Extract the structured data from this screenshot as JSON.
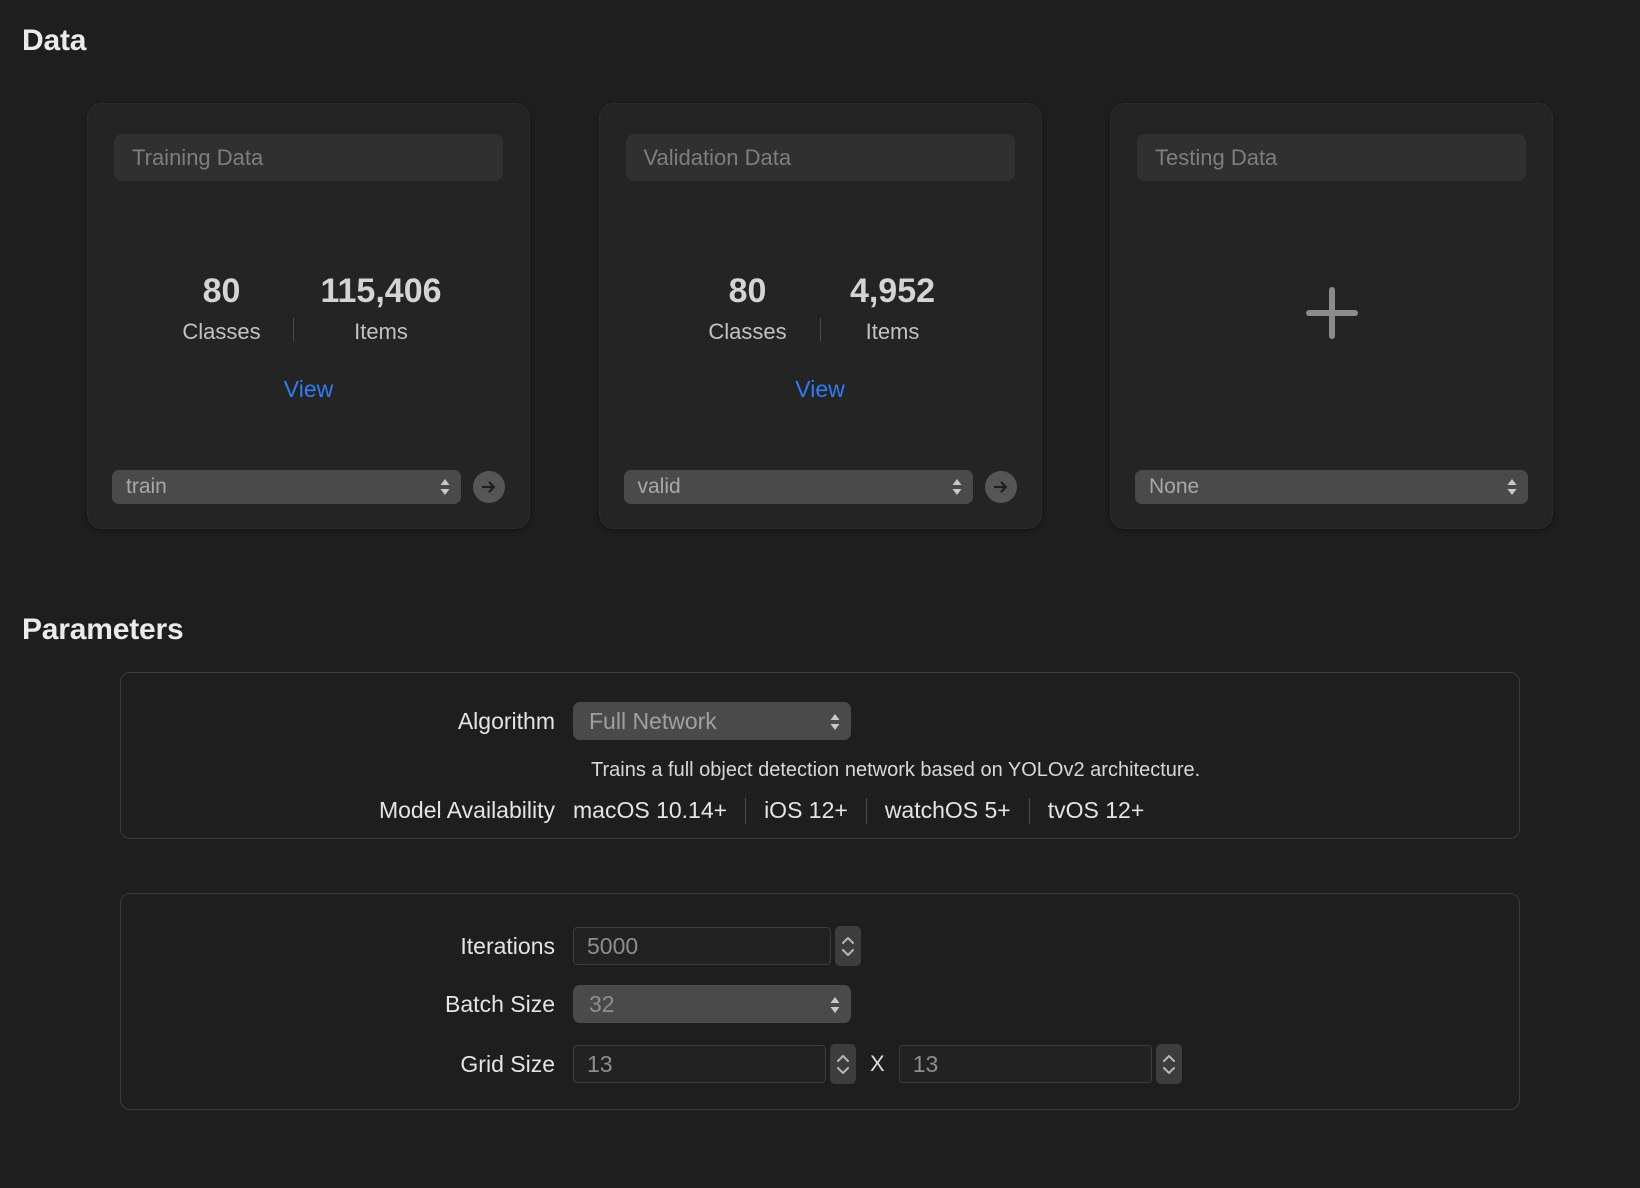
{
  "sections": {
    "data_title": "Data",
    "parameters_title": "Parameters"
  },
  "data_cards": [
    {
      "name": "Training Data",
      "classes_value": "80",
      "classes_label": "Classes",
      "items_value": "115,406",
      "items_label": "Items",
      "view_label": "View",
      "source": "train",
      "has_go_button": true,
      "empty": false
    },
    {
      "name": "Validation Data",
      "classes_value": "80",
      "classes_label": "Classes",
      "items_value": "4,952",
      "items_label": "Items",
      "view_label": "View",
      "source": "valid",
      "has_go_button": true,
      "empty": false
    },
    {
      "name": "Testing Data",
      "source": "None",
      "has_go_button": false,
      "empty": true
    }
  ],
  "parameters": {
    "algorithm": {
      "label": "Algorithm",
      "value": "Full Network",
      "description": "Trains a full object detection network based on YOLOv2 architecture."
    },
    "model_availability": {
      "label": "Model Availability",
      "platforms": [
        "macOS 10.14+",
        "iOS 12+",
        "watchOS 5+",
        "tvOS 12+"
      ]
    },
    "iterations": {
      "label": "Iterations",
      "value": "5000"
    },
    "batch_size": {
      "label": "Batch Size",
      "value": "32"
    },
    "grid_size": {
      "label": "Grid Size",
      "width": "13",
      "height": "13",
      "separator": "X"
    }
  },
  "colors": {
    "background": "#1e1e1e",
    "card": "#242424",
    "accent_link": "#2f7cf6",
    "control": "#4a4a4a"
  }
}
